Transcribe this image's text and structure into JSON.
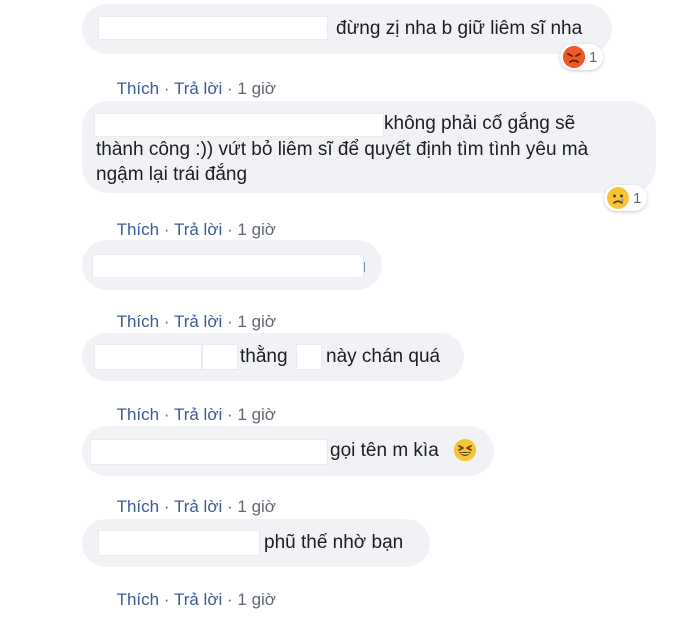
{
  "comments": [
    {
      "text": "đừng zị nha b giữ liêm sĩ nha",
      "reaction": {
        "icon": "angry-face-icon",
        "count": "1"
      }
    },
    {
      "text_lines": [
        "không phải cố gắng sẽ",
        "thành công :)) vứt bỏ liêm sĩ để quyết định tìm tình yêu mà",
        "ngậm lại trái đắng"
      ],
      "reaction": {
        "icon": "sad-face-icon",
        "count": "1"
      }
    },
    {
      "text": ""
    },
    {
      "text_part1": "thằng",
      "text_part2": "này chán quá"
    },
    {
      "text": "gọi tên m kìa",
      "emoji": "laughing-face-icon"
    },
    {
      "text": "phũ thế nhờ bạn"
    }
  ],
  "actions": {
    "like": "Thích",
    "separator": "·",
    "reply": "Trả lời",
    "time": "1 giờ"
  },
  "colors": {
    "bubble": "#f0f2f5",
    "link": "#3b5a98",
    "meta": "#606770",
    "angry": "#e9710f",
    "sad": "#f7c533"
  }
}
